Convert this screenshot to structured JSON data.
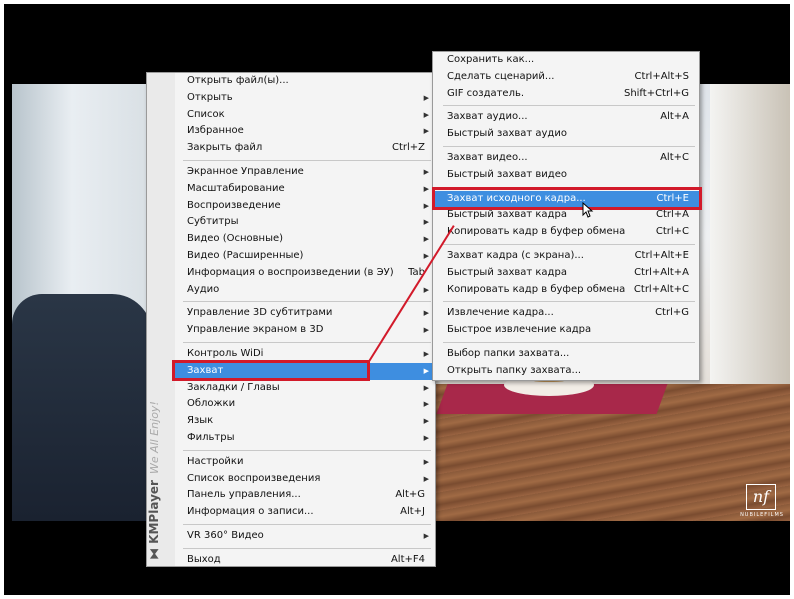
{
  "brand": {
    "name": "KMPlayer",
    "tagline": "We All Enjoy!"
  },
  "watermark": {
    "logo": "nf",
    "subtitle": "NUBILEFILMS"
  },
  "main_menu": {
    "groups": [
      [
        {
          "label": "Открыть файл(ы)...",
          "shortcut": "",
          "submenu": false
        },
        {
          "label": "Открыть",
          "shortcut": "",
          "submenu": true
        },
        {
          "label": "Список",
          "shortcut": "",
          "submenu": true
        },
        {
          "label": "Избранное",
          "shortcut": "",
          "submenu": true
        },
        {
          "label": "Закрыть файл",
          "shortcut": "Ctrl+Z",
          "submenu": false
        }
      ],
      [
        {
          "label": "Экранное Управление",
          "shortcut": "",
          "submenu": true
        },
        {
          "label": "Масштабирование",
          "shortcut": "",
          "submenu": true
        },
        {
          "label": "Воспроизведение",
          "shortcut": "",
          "submenu": true
        },
        {
          "label": "Субтитры",
          "shortcut": "",
          "submenu": true
        },
        {
          "label": "Видео (Основные)",
          "shortcut": "",
          "submenu": true
        },
        {
          "label": "Видео (Расширенные)",
          "shortcut": "",
          "submenu": true
        },
        {
          "label": "Информация о воспроизведении (в ЭУ)",
          "shortcut": "Tab",
          "submenu": false
        },
        {
          "label": "Аудио",
          "shortcut": "",
          "submenu": true
        }
      ],
      [
        {
          "label": "Управление 3D субтитрами",
          "shortcut": "",
          "submenu": true
        },
        {
          "label": "Управление экраном в 3D",
          "shortcut": "",
          "submenu": true
        }
      ],
      [
        {
          "label": "Контроль WiDi",
          "shortcut": "",
          "submenu": true
        },
        {
          "label": "Захват",
          "shortcut": "",
          "submenu": true,
          "highlighted": true
        },
        {
          "label": "Закладки / Главы",
          "shortcut": "",
          "submenu": true
        },
        {
          "label": "Обложки",
          "shortcut": "",
          "submenu": true
        },
        {
          "label": "Язык",
          "shortcut": "",
          "submenu": true
        },
        {
          "label": "Фильтры",
          "shortcut": "",
          "submenu": true
        }
      ],
      [
        {
          "label": "Настройки",
          "shortcut": "",
          "submenu": true
        },
        {
          "label": "Список воспроизведения",
          "shortcut": "",
          "submenu": true
        },
        {
          "label": "Панель управления...",
          "shortcut": "Alt+G",
          "submenu": false
        },
        {
          "label": "Информация о записи...",
          "shortcut": "Alt+J",
          "submenu": false
        }
      ],
      [
        {
          "label": "VR 360° Видео",
          "shortcut": "",
          "submenu": true
        }
      ],
      [
        {
          "label": "Выход",
          "shortcut": "Alt+F4",
          "submenu": false
        }
      ]
    ]
  },
  "capture_menu": {
    "groups": [
      [
        {
          "label": "Сохранить как...",
          "shortcut": ""
        },
        {
          "label": "Сделать сценарий...",
          "shortcut": "Ctrl+Alt+S"
        },
        {
          "label": "GIF создатель.",
          "shortcut": "Shift+Ctrl+G"
        }
      ],
      [
        {
          "label": "Захват аудио...",
          "shortcut": "Alt+A"
        },
        {
          "label": "Быстрый захват аудио",
          "shortcut": ""
        }
      ],
      [
        {
          "label": "Захват видео...",
          "shortcut": "Alt+C"
        },
        {
          "label": "Быстрый захват видео",
          "shortcut": ""
        }
      ],
      [
        {
          "label": "Захват исходного кадра...",
          "shortcut": "Ctrl+E",
          "highlighted": true
        },
        {
          "label": "Быстрый захват кадра",
          "shortcut": "Ctrl+A"
        },
        {
          "label": "Копировать кадр в буфер обмена",
          "shortcut": "Ctrl+C"
        }
      ],
      [
        {
          "label": "Захват кадра (с экрана)...",
          "shortcut": "Ctrl+Alt+E"
        },
        {
          "label": "Быстрый захват кадра",
          "shortcut": "Ctrl+Alt+A"
        },
        {
          "label": "Копировать кадр в буфер обмена",
          "shortcut": "Ctrl+Alt+C"
        }
      ],
      [
        {
          "label": "Извлечение кадра...",
          "shortcut": "Ctrl+G"
        },
        {
          "label": "Быстрое извлечение кадра",
          "shortcut": ""
        }
      ],
      [
        {
          "label": "Выбор папки захвата...",
          "shortcut": ""
        },
        {
          "label": "Открыть папку захвата...",
          "shortcut": ""
        }
      ]
    ]
  },
  "colors": {
    "highlight": "#3e8ee0",
    "annotation": "#d21a2a",
    "menu_bg": "#f4f4f4"
  }
}
